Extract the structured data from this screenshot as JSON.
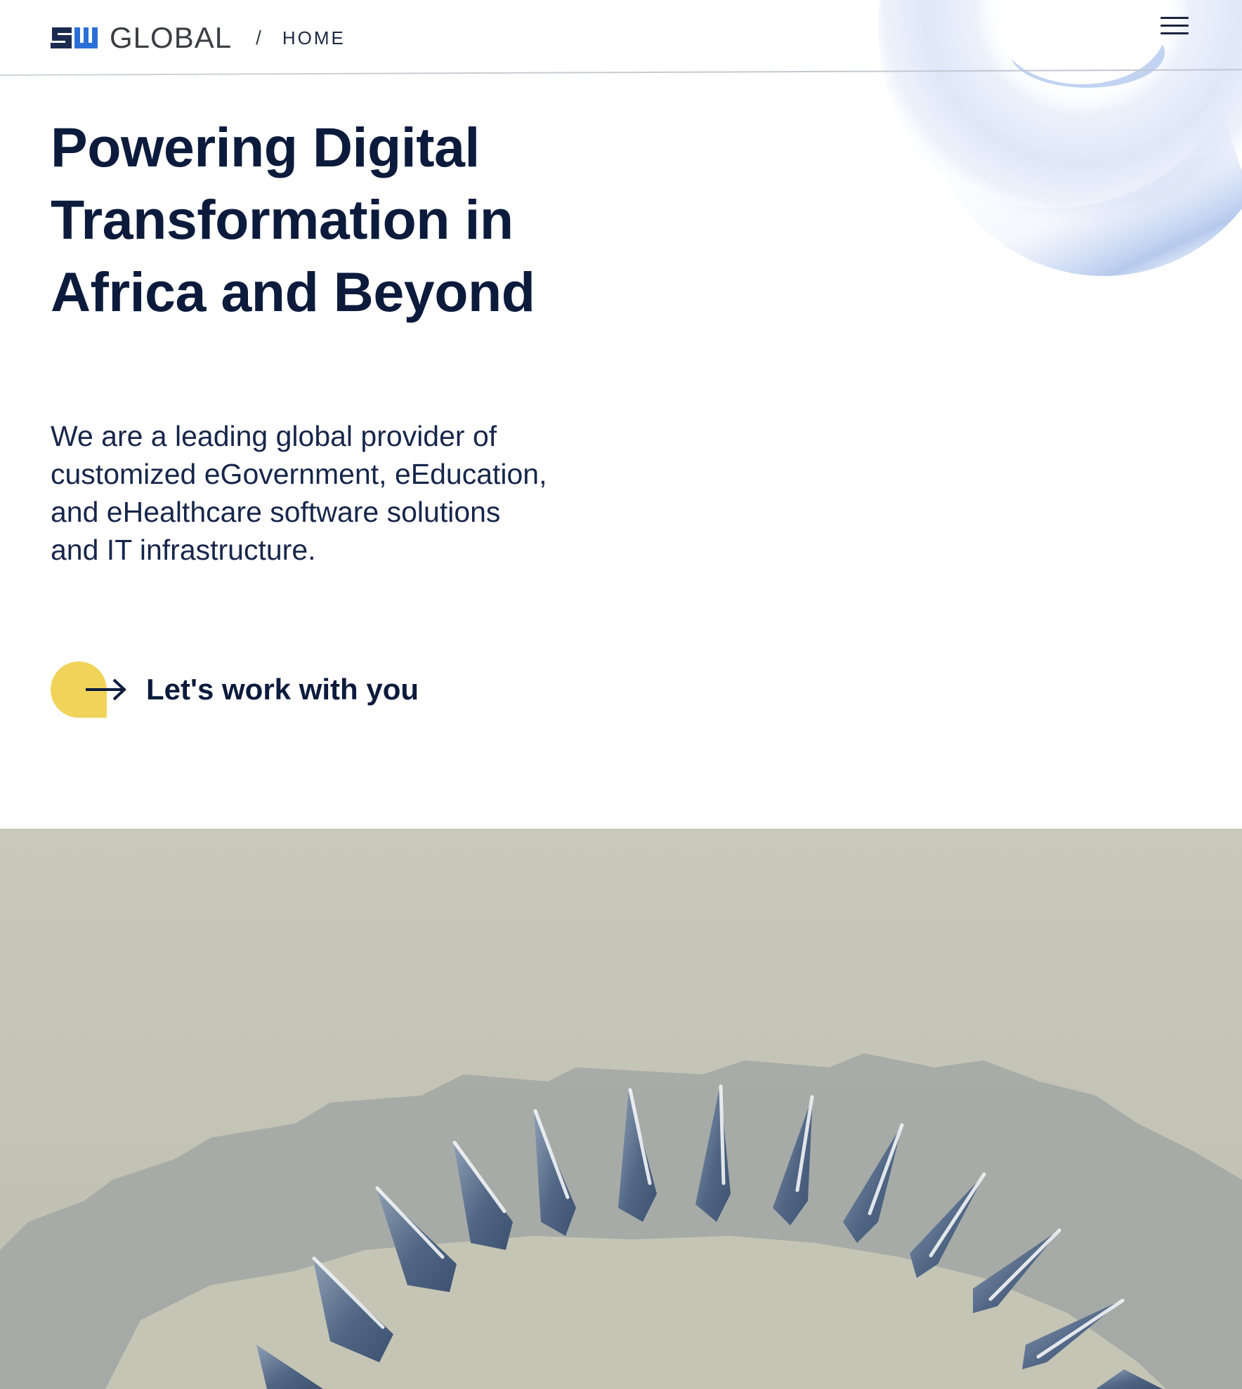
{
  "header": {
    "brand_name": "GLOBAL",
    "breadcrumb_separator": "/",
    "breadcrumb_current": "HOME",
    "menu_icon": "hamburger-menu-icon"
  },
  "hero": {
    "title": "Powering Digital Transformation in Africa and Beyond",
    "title_lines": [
      "Powering Digital",
      "Transformation in",
      "Africa and Beyond"
    ],
    "subtitle_lines": [
      "We are a leading global provider of",
      "customized eGovernment, eEducation,",
      "and eHealthcare software solutions",
      "and IT infrastructure."
    ],
    "cta_label": "Let's work with you",
    "cta_icon": "arrow-right-icon"
  },
  "colors": {
    "navy": "#0c1b3c",
    "brand_blue": "#2b6fd6",
    "brand_dark": "#1b2a4f",
    "cta_yellow": "#f2d35a",
    "photo_background": "#c8c7b9",
    "deco_blue": "#a9c0ea"
  }
}
